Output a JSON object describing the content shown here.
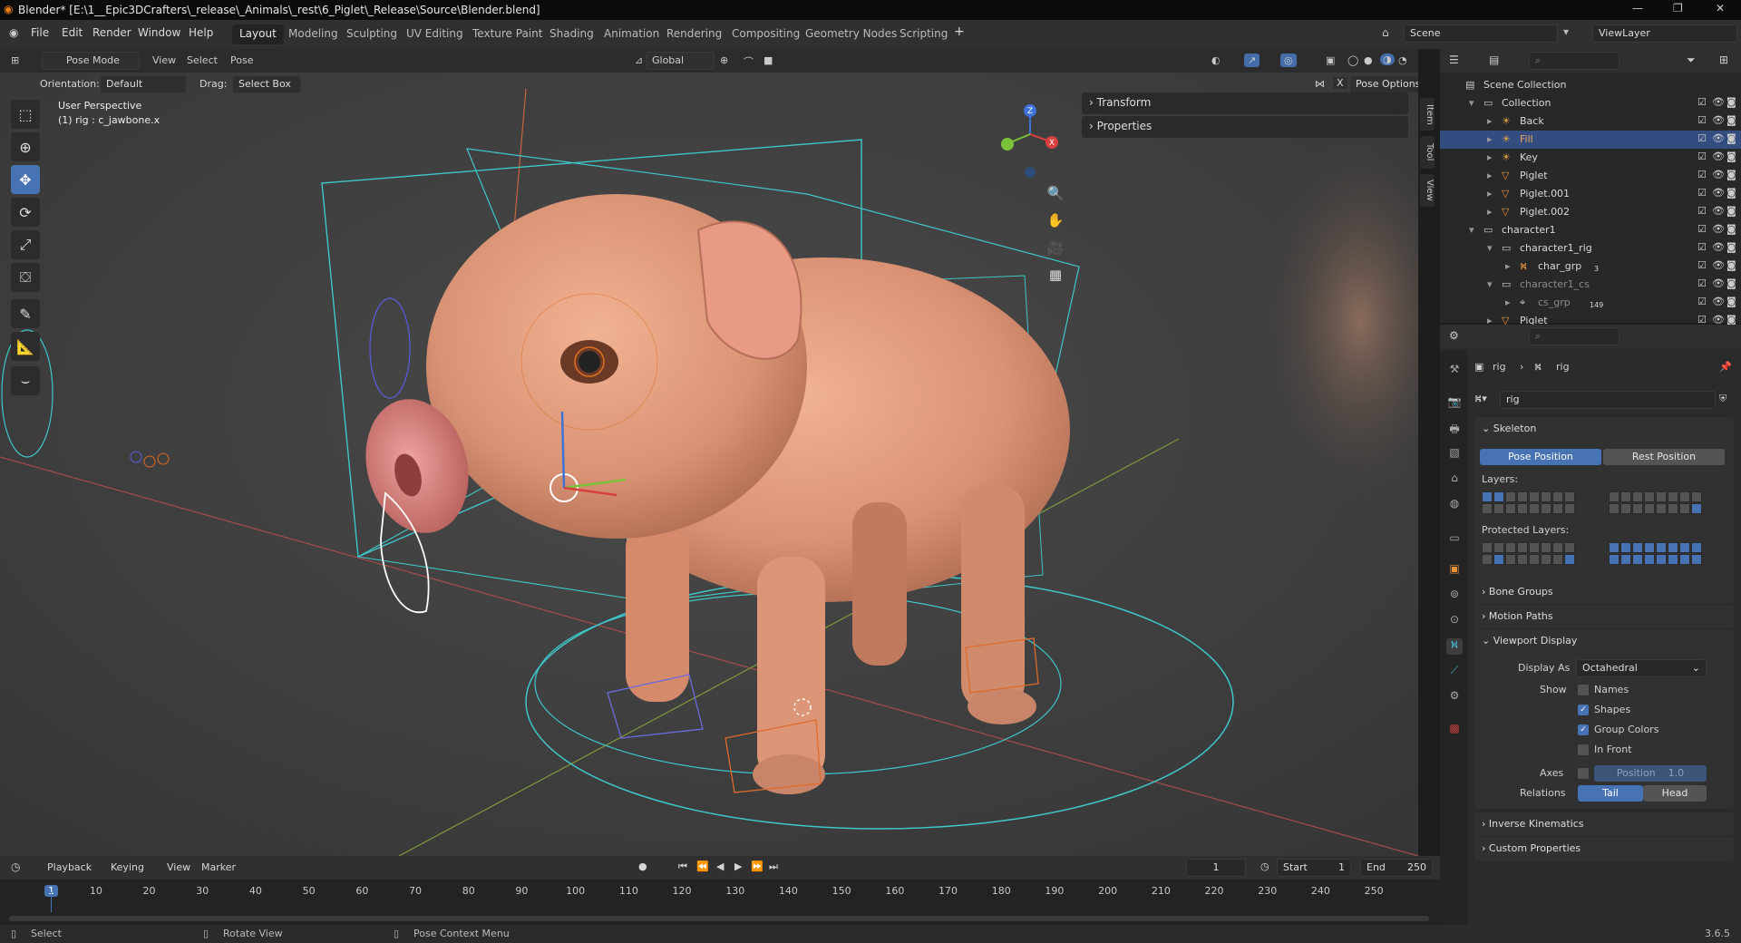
{
  "title_bar": {
    "text": "Blender* [E:\\1__Epic3DCrafters\\_release\\_Animals\\_rest\\6_Piglet\\_Release\\Source\\Blender.blend]"
  },
  "menus": [
    "File",
    "Edit",
    "Render",
    "Window",
    "Help"
  ],
  "workspaces": [
    "Layout",
    "Modeling",
    "Sculpting",
    "UV Editing",
    "Texture Paint",
    "Shading",
    "Animation",
    "Rendering",
    "Compositing",
    "Geometry Nodes",
    "Scripting"
  ],
  "active_workspace": "Layout",
  "scene": {
    "name": "Scene",
    "view_layer": "ViewLayer"
  },
  "viewport": {
    "mode": "Pose Mode",
    "menus": [
      "View",
      "Select",
      "Pose"
    ],
    "transform_orientation": "Global",
    "orientation_label": "Orientation:",
    "orientation_value": "Default",
    "drag_label": "Drag:",
    "drag_value": "Select Box",
    "pose_options": "Pose Options",
    "x_label": "X",
    "overlay_title": "User Perspective",
    "overlay_sub": "(1) rig : c_jawbone.x",
    "panels": [
      "Transform",
      "Properties"
    ],
    "side_tabs": [
      "Item",
      "Tool",
      "View"
    ],
    "gizmo": {
      "x": "X",
      "y": "Y",
      "z": "Z"
    }
  },
  "outliner": {
    "rows": [
      {
        "name": "Scene Collection",
        "indent": 0,
        "expand": "",
        "icon": "scene-collection-icon",
        "sel": false,
        "dim": false
      },
      {
        "name": "Collection",
        "indent": 1,
        "expand": "▾",
        "icon": "collection-icon",
        "sel": false,
        "dim": false
      },
      {
        "name": "Back",
        "indent": 2,
        "expand": "▸",
        "icon": "light-icon",
        "sel": false,
        "dim": false
      },
      {
        "name": "Fill",
        "indent": 2,
        "expand": "▸",
        "icon": "light-icon",
        "sel": true,
        "dim": false
      },
      {
        "name": "Key",
        "indent": 2,
        "expand": "▸",
        "icon": "light-icon",
        "sel": false,
        "dim": false
      },
      {
        "name": "Piglet",
        "indent": 2,
        "expand": "▸",
        "icon": "mesh-icon",
        "sel": false,
        "dim": false
      },
      {
        "name": "Piglet.001",
        "indent": 2,
        "expand": "▸",
        "icon": "mesh-icon",
        "sel": false,
        "dim": false
      },
      {
        "name": "Piglet.002",
        "indent": 2,
        "expand": "▸",
        "icon": "mesh-icon",
        "sel": false,
        "dim": false
      },
      {
        "name": "character1",
        "indent": 1,
        "expand": "▾",
        "icon": "collection-icon",
        "sel": false,
        "dim": false
      },
      {
        "name": "character1_rig",
        "indent": 2,
        "expand": "▾",
        "icon": "collection-icon",
        "sel": false,
        "dim": false
      },
      {
        "name": "char_grp",
        "indent": 3,
        "expand": "▸",
        "icon": "armature-icon",
        "sel": false,
        "dim": false
      },
      {
        "name": "character1_cs",
        "indent": 2,
        "expand": "▾",
        "icon": "collection-icon",
        "sel": false,
        "dim": true
      },
      {
        "name": "cs_grp",
        "indent": 3,
        "expand": "▸",
        "icon": "empty-icon",
        "sel": false,
        "dim": true
      },
      {
        "name": "Piglet",
        "indent": 2,
        "expand": "▸",
        "icon": "mesh-icon",
        "sel": false,
        "dim": false
      }
    ],
    "cs_count": "149",
    "char_grp_count": "3"
  },
  "properties": {
    "breadcrumb": [
      "rig",
      "rig"
    ],
    "data_name": "rig",
    "skeleton": "Skeleton",
    "pose_position": "Pose Position",
    "rest_position": "Rest Position",
    "layers_label": "Layers:",
    "protected_label": "Protected Layers:",
    "bone_groups": "Bone Groups",
    "motion_paths": "Motion Paths",
    "viewport_display": "Viewport Display",
    "display_as_label": "Display As",
    "display_as_value": "Octahedral",
    "show_label": "Show",
    "show_names": "Names",
    "show_shapes": "Shapes",
    "show_group_colors": "Group Colors",
    "in_front": "In Front",
    "axes_label": "Axes",
    "axes_position": "Position",
    "axes_value": "1.0",
    "relations_label": "Relations",
    "tail": "Tail",
    "head": "Head",
    "inverse_kinematics": "Inverse Kinematics",
    "custom_properties": "Custom Properties"
  },
  "timeline": {
    "menus": [
      "Playback",
      "Keying",
      "View",
      "Marker"
    ],
    "current_frame": "1",
    "start_label": "Start",
    "start": "1",
    "end_label": "End",
    "end": "250",
    "ruler": [
      "1",
      "10",
      "20",
      "30",
      "40",
      "50",
      "60",
      "70",
      "80",
      "90",
      "100",
      "110",
      "120",
      "130",
      "140",
      "150",
      "160",
      "170",
      "180",
      "190",
      "200",
      "210",
      "220",
      "230",
      "240",
      "250"
    ]
  },
  "status_bar": {
    "select": "Select",
    "rotate": "Rotate View",
    "context": "Pose Context Menu",
    "version": "3.6.5"
  },
  "colors": {
    "accent": "#4772b3",
    "selected_row": "#334d80",
    "rig_lines": "#3fc6c8",
    "pig_skin": "#e7a27e"
  }
}
